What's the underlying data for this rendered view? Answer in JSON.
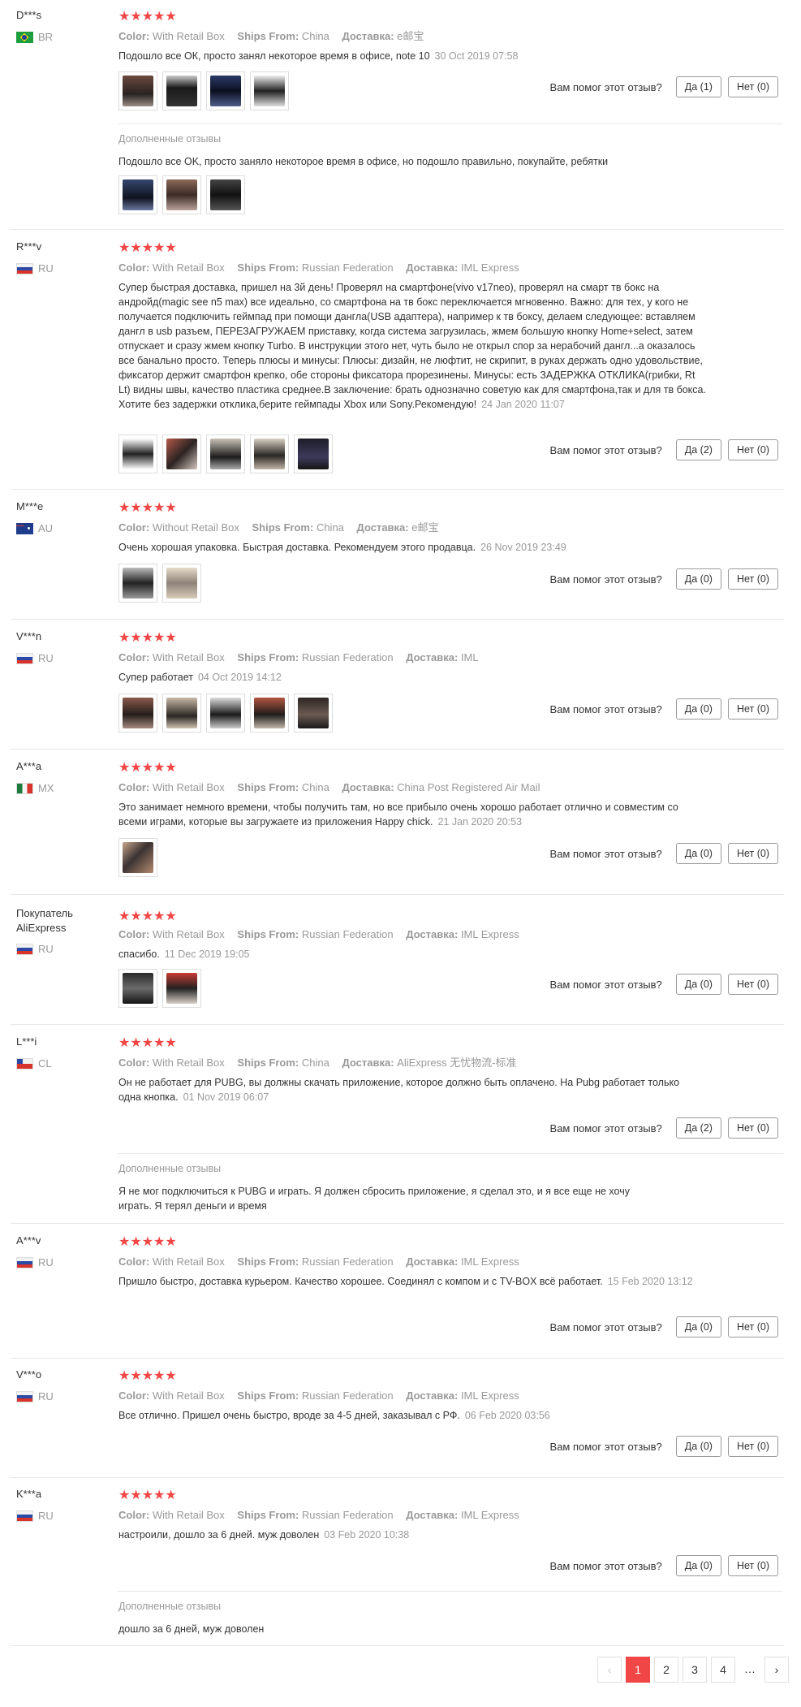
{
  "labels": {
    "color": "Color:",
    "ships_from": "Ships From:",
    "delivery": "Доставка:",
    "helpful_question": "Вам помог этот отзыв?",
    "additional_reviews": "Дополненные отзывы"
  },
  "reviews": [
    {
      "user": "D***s",
      "country": "BR",
      "stars": "★★★★★",
      "color": "With Retail Box",
      "ships_from": "China",
      "delivery": "e邮宝",
      "text": "Подошло все ОК, просто занял некоторое время в офисе, note 10",
      "date": "30 Oct 2019 07:58",
      "yes": "Да (1)",
      "no": "Нет (0)",
      "additional": "Подошло все OK, просто заняло некоторое время в офисе, но подошло правильно, покупайте, ребятки"
    },
    {
      "user": "R***v",
      "country": "RU",
      "stars": "★★★★★",
      "color": "With Retail Box",
      "ships_from": "Russian Federation",
      "delivery": "IML Express",
      "text": "Супер быстрая доставка, пришел на 3й день! Проверял на смартфоне(vivo v17neo), проверял на смарт тв бокс на андройд(magic see n5 max) все идеально, со смартфона на тв бокс переключается мгновенно. Важно: для тех, у кого не получается подключить геймпад при помощи дангла(USB адаптера), например к тв боксу, делаем следующее: вставляем дангл в usb разъем, ПЕРЕЗАГРУЖАЕМ приставку, когда система загрузилась, жмем большую кнопку Home+select, затем отпускает и сразу жмем кнопку Turbo. В инструкции этого нет, чуть было не открыл спор за нерабочий дангл...а оказалось все банально просто. Теперь плюсы и минусы: Плюсы: дизайн, не люфтит, не скрипит, в руках держать одно удовольствие, фиксатор держит смартфон крепко, обе стороны фиксатора прорезинены. Минусы: есть ЗАДЕРЖКА ОТКЛИКА(грибки, Rt Lt) видны швы, качество пластика среднее.В заключение: брать однозначно советую как для смартфона,так и для тв бокса. Хотите без задержки отклика,берите геймпады Xbox или Sony.Рекомендую!",
      "date": "24 Jan 2020 11:07",
      "yes": "Да (2)",
      "no": "Нет (0)"
    },
    {
      "user": "M***e",
      "country": "AU",
      "stars": "★★★★★",
      "color": "Without Retail Box",
      "ships_from": "China",
      "delivery": "e邮宝",
      "text": "Очень хорошая упаковка. Быстрая доставка. Рекомендуем этого продавца.",
      "date": "26 Nov 2019 23:49",
      "yes": "Да (0)",
      "no": "Нет (0)"
    },
    {
      "user": "V***n",
      "country": "RU",
      "stars": "★★★★★",
      "color": "With Retail Box",
      "ships_from": "Russian Federation",
      "delivery": "IML",
      "text": "Супер работает",
      "date": "04 Oct 2019 14:12",
      "yes": "Да (0)",
      "no": "Нет (0)"
    },
    {
      "user": "A***a",
      "country": "MX",
      "stars": "★★★★★",
      "color": "With Retail Box",
      "ships_from": "China",
      "delivery": "China Post Registered Air Mail",
      "text": "Это занимает немного времени, чтобы получить там, но все прибыло очень хорошо работает отлично и совместим со всеми играми, которые вы загружаете из приложения Happy chick.",
      "date": "21 Jan 2020 20:53",
      "yes": "Да (0)",
      "no": "Нет (0)"
    },
    {
      "user": "Покупатель AliExpress",
      "country": "RU",
      "stars": "★★★★★",
      "color": "With Retail Box",
      "ships_from": "Russian Federation",
      "delivery": "IML Express",
      "text": "спасибо.",
      "date": "11 Dec 2019 19:05",
      "yes": "Да (0)",
      "no": "Нет (0)"
    },
    {
      "user": "L***i",
      "country": "CL",
      "stars": "★★★★★",
      "color": "With Retail Box",
      "ships_from": "China",
      "delivery": "AliExpress 无忧物流-标准",
      "text": "Он не работает для PUBG, вы должны скачать приложение, которое должно быть оплачено. На Pubg работает только одна кнопка.",
      "date": "01 Nov 2019 06:07",
      "yes": "Да (2)",
      "no": "Нет (0)",
      "additional": "Я не мог подключиться к PUBG и играть. Я должен сбросить приложение, я сделал это, и я все еще не хочу играть. Я терял деньги и время"
    },
    {
      "user": "A***v",
      "country": "RU",
      "stars": "★★★★★",
      "color": "With Retail Box",
      "ships_from": "Russian Federation",
      "delivery": "IML Express",
      "text": "Пришло быстро, доставка курьером. Качество хорошее. Соединял с компом и с TV-BOX всё работает.",
      "date": "15 Feb 2020 13:12",
      "yes": "Да (0)",
      "no": "Нет (0)"
    },
    {
      "user": "V***o",
      "country": "RU",
      "stars": "★★★★★",
      "color": "With Retail Box",
      "ships_from": "Russian Federation",
      "delivery": "IML Express",
      "text": "Все отлично. Пришел очень быстро, вроде за 4-5 дней, заказывал с РФ.",
      "date": "06 Feb 2020 03:56",
      "yes": "Да (0)",
      "no": "Нет (0)"
    },
    {
      "user": "K***a",
      "country": "RU",
      "stars": "★★★★★",
      "color": "With Retail Box",
      "ships_from": "Russian Federation",
      "delivery": "IML Express",
      "text": "настроили, дошло за 6 дней. муж доволен",
      "date": "03 Feb 2020 10:38",
      "yes": "Да (0)",
      "no": "Нет (0)",
      "additional": "дошло за 6 дней, муж доволен"
    }
  ],
  "pagination": {
    "prev": "‹",
    "pages": [
      "1",
      "2",
      "3",
      "4"
    ],
    "ellipsis": "…",
    "next": "›"
  }
}
